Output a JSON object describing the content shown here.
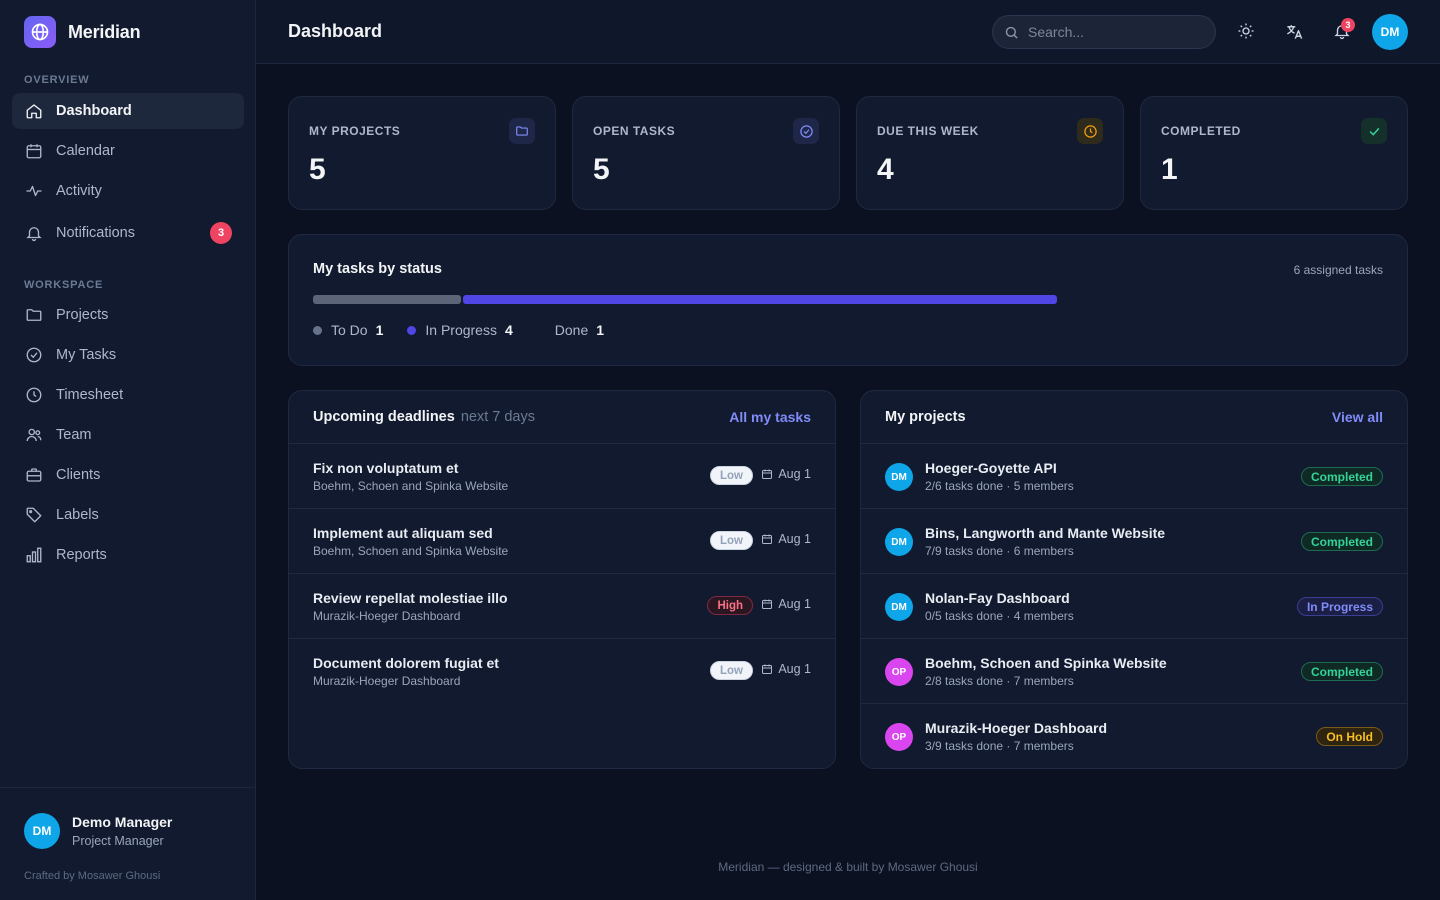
{
  "brand": {
    "name": "Meridian"
  },
  "sidebar": {
    "overview_label": "OVERVIEW",
    "workspace_label": "WORKSPACE",
    "overview_items": [
      {
        "label": "Dashboard",
        "icon": "home-icon"
      },
      {
        "label": "Calendar",
        "icon": "calendar-icon"
      },
      {
        "label": "Activity",
        "icon": "activity-icon"
      },
      {
        "label": "Notifications",
        "icon": "bell-icon",
        "badge": "3"
      }
    ],
    "workspace_items": [
      {
        "label": "Projects",
        "icon": "folder-icon"
      },
      {
        "label": "My Tasks",
        "icon": "check-circle-icon"
      },
      {
        "label": "Timesheet",
        "icon": "clock-icon"
      },
      {
        "label": "Team",
        "icon": "users-icon"
      },
      {
        "label": "Clients",
        "icon": "briefcase-icon"
      },
      {
        "label": "Labels",
        "icon": "tag-icon"
      },
      {
        "label": "Reports",
        "icon": "bar-chart-icon"
      }
    ],
    "user": {
      "initials": "DM",
      "name": "Demo Manager",
      "role": "Project Manager"
    },
    "crafted": "Crafted by Mosawer Ghousi"
  },
  "topbar": {
    "title": "Dashboard",
    "search_placeholder": "Search...",
    "notification_count": "3",
    "avatar_initials": "DM"
  },
  "stats": [
    {
      "label": "MY PROJECTS",
      "value": "5",
      "icon": "folder-icon",
      "color": "#818cf8",
      "bg": "#1e2747"
    },
    {
      "label": "OPEN TASKS",
      "value": "5",
      "icon": "check-circle-icon",
      "color": "#818cf8",
      "bg": "#1e2747"
    },
    {
      "label": "DUE THIS WEEK",
      "value": "4",
      "icon": "clock-icon",
      "color": "#f59e0b",
      "bg": "#2e2a1c"
    },
    {
      "label": "COMPLETED",
      "value": "1",
      "icon": "check-icon",
      "color": "#34d399",
      "bg": "#15302a"
    }
  ],
  "task_status": {
    "title": "My tasks by status",
    "meta": "6 assigned tasks",
    "items": [
      {
        "label": "To Do",
        "count": "1",
        "value": 1,
        "color": "#64748b"
      },
      {
        "label": "In Progress",
        "count": "4",
        "value": 4,
        "color": "#4f46e5"
      },
      {
        "label": "Done",
        "count": "1",
        "value": 1,
        "color": "#10b981"
      }
    ]
  },
  "deadlines": {
    "title": "Upcoming deadlines",
    "subtitle": "next 7 days",
    "link": "All my tasks",
    "rows": [
      {
        "title": "Fix non voluptatum et",
        "project": "Boehm, Schoen and Spinka Website",
        "priority": "Low",
        "due": "Aug 1"
      },
      {
        "title": "Implement aut aliquam sed",
        "project": "Boehm, Schoen and Spinka Website",
        "priority": "Low",
        "due": "Aug 1"
      },
      {
        "title": "Review repellat molestiae illo",
        "project": "Murazik-Hoeger Dashboard",
        "priority": "High",
        "due": "Aug 1"
      },
      {
        "title": "Document dolorem fugiat et",
        "project": "Murazik-Hoeger Dashboard",
        "priority": "Low",
        "due": "Aug 1"
      }
    ]
  },
  "projects": {
    "title": "My projects",
    "link": "View all",
    "rows": [
      {
        "initials": "DM",
        "avatar_color": "#0ea5e9",
        "name": "Hoeger-Goyette API",
        "meta": "2/6 tasks done · 5 members",
        "status": "Completed",
        "status_kind": "completed"
      },
      {
        "initials": "DM",
        "avatar_color": "#0ea5e9",
        "name": "Bins, Langworth and Mante Website",
        "meta": "7/9 tasks done · 6 members",
        "status": "Completed",
        "status_kind": "completed"
      },
      {
        "initials": "DM",
        "avatar_color": "#0ea5e9",
        "name": "Nolan-Fay Dashboard",
        "meta": "0/5 tasks done · 4 members",
        "status": "In Progress",
        "status_kind": "progress"
      },
      {
        "initials": "OP",
        "avatar_color": "#d946ef",
        "name": "Boehm, Schoen and Spinka Website",
        "meta": "2/8 tasks done · 7 members",
        "status": "Completed",
        "status_kind": "completed"
      },
      {
        "initials": "OP",
        "avatar_color": "#d946ef",
        "name": "Murazik-Hoeger Dashboard",
        "meta": "3/9 tasks done · 7 members",
        "status": "On Hold",
        "status_kind": "hold"
      }
    ]
  },
  "footer": "Meridian — designed & built by Mosawer Ghousi"
}
